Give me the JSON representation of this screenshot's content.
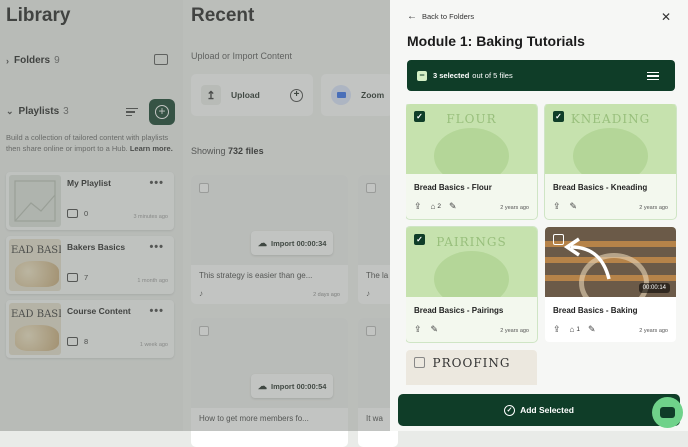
{
  "library": {
    "title": "Library",
    "folders_label": "Folders",
    "folders_count": "9",
    "playlists_label": "Playlists",
    "playlists_count": "3",
    "description": "Build a collection of tailored content with playlists then share online or import to a Hub.",
    "learn_more": "Learn more.",
    "playlists": [
      {
        "title": "My Playlist",
        "count": "0",
        "ago": "3 minutes ago"
      },
      {
        "title": "Bakers Basics",
        "count": "7",
        "ago": "1 month ago",
        "thumb_text": "EAD BASIC"
      },
      {
        "title": "Course Content",
        "count": "8",
        "ago": "1 week ago",
        "thumb_text": "EAD BASIC"
      }
    ]
  },
  "recent": {
    "title": "Recent",
    "upload_heading": "Upload or Import Content",
    "upload_label": "Upload",
    "zoom_label": "Zoom",
    "showing_prefix": "Showing",
    "showing_count": "732 files",
    "import_label": "Import",
    "videos": [
      {
        "duration": "00:00:34",
        "title": "This strategy is easier than ge...",
        "ago": "2 days ago",
        "partial_title": "The la"
      },
      {
        "duration": "00:00:54",
        "title": "How to get more members fo...",
        "partial_title": "It wa"
      }
    ]
  },
  "panel": {
    "back_label": "Back to Folders",
    "title": "Module 1: Baking Tutorials",
    "selected_text": "3 selected",
    "out_of_text": "out of 5 files",
    "files": [
      {
        "title": "Bread Basics - Flour",
        "thumb_word": "FLOUR",
        "tags": "2",
        "date": "2 years ago",
        "selected": true
      },
      {
        "title": "Bread Basics - Kneading",
        "thumb_word": "KNEADING",
        "date": "2 years ago",
        "selected": true
      },
      {
        "title": "Bread Basics - Pairings",
        "thumb_word": "PAIRINGS",
        "date": "2 years ago",
        "selected": true
      },
      {
        "title": "Bread Basics - Baking",
        "duration": "00:00:14",
        "tags": "1",
        "date": "2 years ago",
        "selected": false
      },
      {
        "title": "",
        "thumb_word": "PROOFING",
        "selected": false
      }
    ],
    "add_selected": "Add Selected"
  },
  "colors": {
    "primary": "#0f3d28",
    "thumb_green": "#c6e2ae",
    "chat": "#6fd28a"
  }
}
